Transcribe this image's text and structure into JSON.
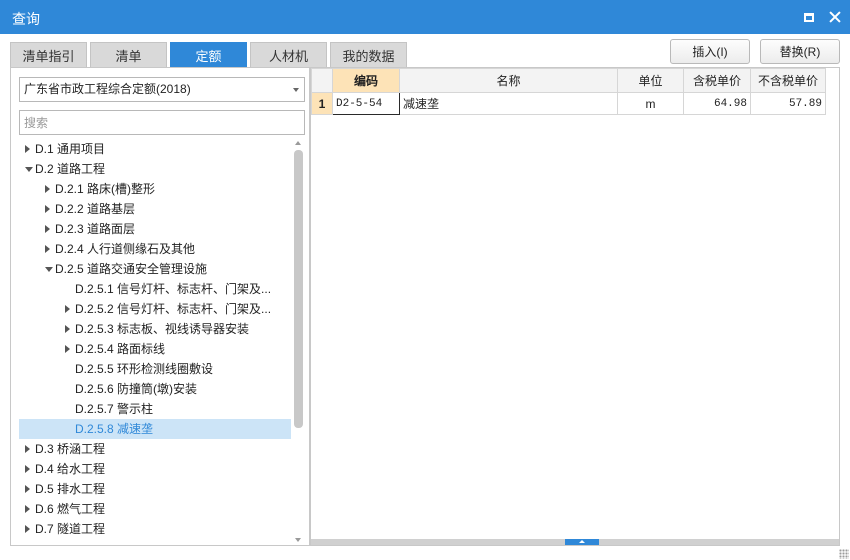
{
  "window": {
    "title": "查询",
    "restore_icon": "restore-icon",
    "close_icon": "close-icon",
    "accent_color": "#2f88d8"
  },
  "tabs": [
    {
      "label": "清单指引",
      "active": false
    },
    {
      "label": "清单",
      "active": false
    },
    {
      "label": "定额",
      "active": true
    },
    {
      "label": "人材机",
      "active": false
    },
    {
      "label": "我的数据",
      "active": false
    }
  ],
  "actions": {
    "insert_label": "插入(I)",
    "replace_label": "替换(R)"
  },
  "left": {
    "quota_library": "广东省市政工程综合定额(2018)",
    "search_placeholder": "搜索",
    "tree": [
      {
        "label": "D.1 通用项目",
        "level": 0,
        "arrow": "collapsed"
      },
      {
        "label": "D.2 道路工程",
        "level": 0,
        "arrow": "expanded"
      },
      {
        "label": "D.2.1 路床(槽)整形",
        "level": 1,
        "arrow": "collapsed"
      },
      {
        "label": "D.2.2 道路基层",
        "level": 1,
        "arrow": "collapsed"
      },
      {
        "label": "D.2.3 道路面层",
        "level": 1,
        "arrow": "collapsed"
      },
      {
        "label": "D.2.4 人行道侧缘石及其他",
        "level": 1,
        "arrow": "collapsed"
      },
      {
        "label": "D.2.5 道路交通安全管理设施",
        "level": 1,
        "arrow": "expanded"
      },
      {
        "label": "D.2.5.1 信号灯杆、标志杆、门架及...",
        "level": 2,
        "arrow": "none"
      },
      {
        "label": "D.2.5.2 信号灯杆、标志杆、门架及...",
        "level": 2,
        "arrow": "collapsed"
      },
      {
        "label": "D.2.5.3 标志板、视线诱导器安装",
        "level": 2,
        "arrow": "collapsed"
      },
      {
        "label": "D.2.5.4 路面标线",
        "level": 2,
        "arrow": "collapsed"
      },
      {
        "label": "D.2.5.5 环形检测线圈敷设",
        "level": 2,
        "arrow": "none"
      },
      {
        "label": "D.2.5.6 防撞筒(墩)安装",
        "level": 2,
        "arrow": "none"
      },
      {
        "label": "D.2.5.7 警示柱",
        "level": 2,
        "arrow": "none"
      },
      {
        "label": "D.2.5.8 减速垄",
        "level": 2,
        "arrow": "none",
        "selected": true
      },
      {
        "label": "D.3 桥涵工程",
        "level": 0,
        "arrow": "collapsed"
      },
      {
        "label": "D.4 给水工程",
        "level": 0,
        "arrow": "collapsed"
      },
      {
        "label": "D.5 排水工程",
        "level": 0,
        "arrow": "collapsed"
      },
      {
        "label": "D.6 燃气工程",
        "level": 0,
        "arrow": "collapsed"
      },
      {
        "label": "D.7 隧道工程",
        "level": 0,
        "arrow": "collapsed"
      }
    ]
  },
  "grid": {
    "columns": [
      "编码",
      "名称",
      "单位",
      "含税单价",
      "不含税单价"
    ],
    "rows": [
      {
        "index": "1",
        "code": "D2-5-54",
        "name": "减速垄",
        "unit": "m",
        "price_tax": "64.98",
        "price_notax": "57.89"
      }
    ]
  }
}
